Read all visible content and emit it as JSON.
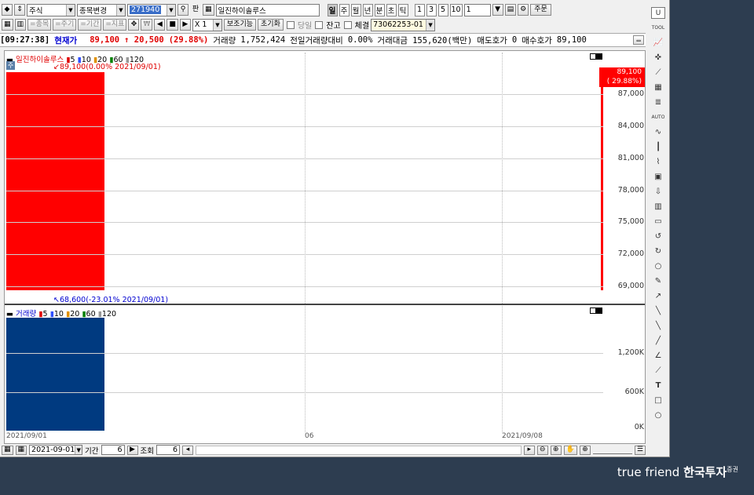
{
  "toolbar1": {
    "market_combo": "주식",
    "stock_change_combo": "종목변경",
    "stock_code": "271940",
    "stock_name": "일진하이솔루스",
    "period_buttons": [
      "일",
      "주",
      "월",
      "년",
      "분",
      "초",
      "틱"
    ],
    "interval_buttons": [
      "1",
      "3",
      "5",
      "10"
    ],
    "interval_value": "1",
    "order_label": "주문"
  },
  "toolbar2": {
    "items_btn": "=종목",
    "cycle_btn": "=주기",
    "range_btn": "=기간",
    "indicator_btn": "=지표",
    "multiplier": "X 1",
    "aux_function": "보조기능",
    "reset": "초기화",
    "today_label": "당일",
    "balance_label": "잔고",
    "fill_label": "체결",
    "account": "73062253-01"
  },
  "quote": {
    "time": "[09:27:38]",
    "current_label": "현재가",
    "price": "89,100",
    "change": "↑ 20,500",
    "change_pct": "(29.88%)",
    "volume_label": "거래량",
    "volume": "1,752,424",
    "prev_vol_label": "전일거래량대비",
    "prev_vol": "0.00%",
    "amount_label": "거래대금",
    "amount": "155,620(백만)",
    "ask_label": "매도호가",
    "ask": "0",
    "bid_label": "매수호가",
    "bid": "89,100"
  },
  "price_panel": {
    "legend_name": "일진하이솔루스",
    "ma": [
      "5",
      "10",
      "20",
      "60",
      "120"
    ],
    "high_note": "89,100(0.00% 2021/09/01)",
    "low_note": "68,600(-23.01% 2021/09/01)",
    "current_tag": "89,100",
    "current_tag_pct": "( 29.88%)",
    "y_ticks": [
      "87,000",
      "84,000",
      "81,000",
      "78,000",
      "75,000",
      "72,000",
      "69,000"
    ]
  },
  "volume_panel": {
    "legend_name": "거래량",
    "ma": [
      "5",
      "10",
      "20",
      "60",
      "120"
    ],
    "y_ticks": [
      "1,200K",
      "600K",
      "0K"
    ]
  },
  "x_ticks": [
    "2021/09/01",
    "06",
    "2021/09/08"
  ],
  "statusbar": {
    "date": "2021-09-01",
    "period_label": "기간",
    "period_value": "6",
    "view_label": "조회",
    "view_value": "6"
  },
  "right_toolbar": [
    "U",
    "TOOL",
    "chart-icon",
    "crosshair-icon",
    "trend-icon",
    "grid-icon",
    "fib-icon",
    "AUTO",
    "wave-icon",
    "candle-icon",
    "line-icon",
    "box-icon",
    "download-icon",
    "table-icon",
    "window-icon",
    "undo-icon",
    "redo-icon",
    "zoom-icon",
    "pencil-icon",
    "arrow-icon",
    "diag-icon",
    "diag2-icon",
    "slash-icon",
    "angle-icon",
    "ruler-icon",
    "T",
    "rect-icon",
    "circle-icon"
  ],
  "logo": {
    "brand": "true friend",
    "company": "한국투자",
    "suffix": "증권"
  },
  "colors": {
    "up": "#ff0000",
    "volume_bar": "#003a80",
    "code_bg": "#3a6ec8"
  },
  "chart_data": [
    {
      "type": "candlestick",
      "x": [
        "2021/09/01"
      ],
      "open": [
        68600
      ],
      "high": [
        89100
      ],
      "low": [
        68600
      ],
      "close": [
        89100
      ],
      "ylim": [
        67500,
        89100
      ]
    },
    {
      "type": "bar",
      "categories": [
        "2021/09/01"
      ],
      "values": [
        1752424
      ],
      "ylim": [
        0,
        1752424
      ]
    }
  ]
}
